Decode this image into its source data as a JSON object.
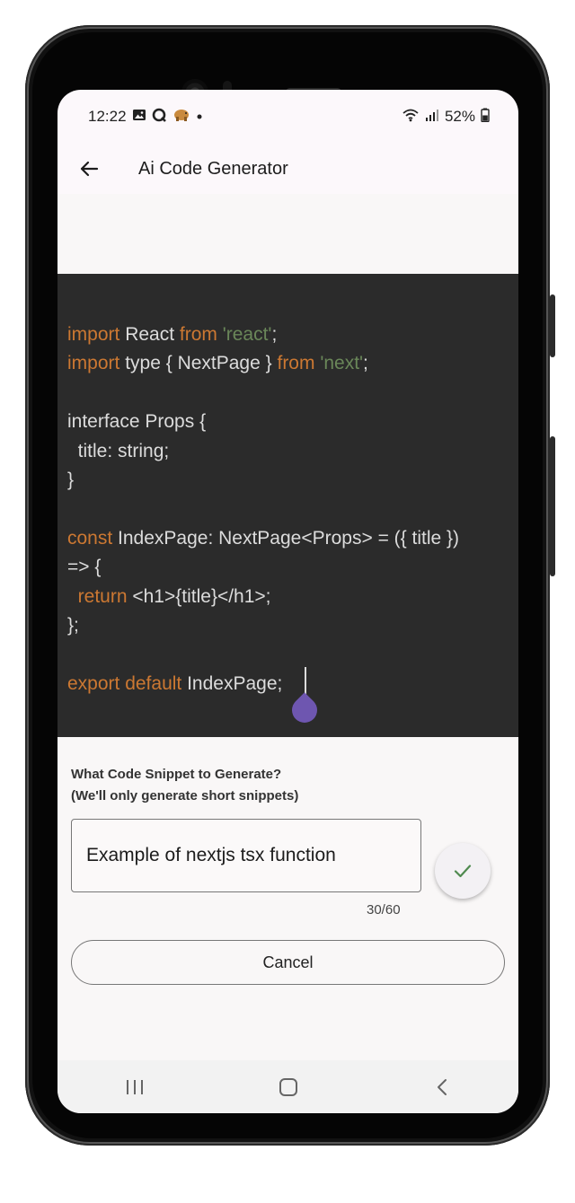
{
  "status_bar": {
    "time": "12:22",
    "battery": "52%",
    "left_icons": [
      "image-icon",
      "search-app-icon",
      "mastodon-icon",
      "dot-icon"
    ],
    "right_icons": [
      "wifi-icon",
      "signal-icon",
      "battery-icon"
    ]
  },
  "app_bar": {
    "title": "Ai Code Generator",
    "back_icon": "arrow-left-icon"
  },
  "code": {
    "colors": {
      "background": "#2b2b2b",
      "keyword": "#cc7832",
      "string": "#6a8759",
      "text": "#dcdcdc"
    },
    "lines": [
      [
        {
          "t": "import",
          "c": "kw"
        },
        {
          "t": " React ",
          "c": ""
        },
        {
          "t": "from",
          "c": "kw"
        },
        {
          "t": " ",
          "c": ""
        },
        {
          "t": "'react'",
          "c": "str"
        },
        {
          "t": ";",
          "c": ""
        }
      ],
      [
        {
          "t": "import",
          "c": "kw"
        },
        {
          "t": " type { NextPage } ",
          "c": ""
        },
        {
          "t": "from",
          "c": "kw"
        },
        {
          "t": " ",
          "c": ""
        },
        {
          "t": "'next'",
          "c": "str"
        },
        {
          "t": ";",
          "c": ""
        }
      ],
      [],
      [
        {
          "t": "interface Props {",
          "c": ""
        }
      ],
      [
        {
          "t": "  title: string;",
          "c": ""
        }
      ],
      [
        {
          "t": "}",
          "c": ""
        }
      ],
      [],
      [
        {
          "t": "const",
          "c": "kw"
        },
        {
          "t": " IndexPage: NextPage<Props> = ({ title })",
          "c": ""
        }
      ],
      [
        {
          "t": "=> {",
          "c": ""
        }
      ],
      [
        {
          "t": "  ",
          "c": ""
        },
        {
          "t": "return",
          "c": "kw"
        },
        {
          "t": " <h1>{title}</h1>;",
          "c": ""
        }
      ],
      [
        {
          "t": "};",
          "c": ""
        }
      ],
      [],
      [
        {
          "t": "export default",
          "c": "kw"
        },
        {
          "t": " IndexPage;",
          "c": ""
        }
      ]
    ]
  },
  "form": {
    "label_line1": "What Code Snippet to Generate?",
    "label_line2": "(We'll only generate short snippets)",
    "input_value": "Example of nextjs tsx function",
    "counter": "30/60",
    "confirm_icon": "check-icon",
    "confirm_color": "#4f8a4f",
    "cancel_label": "Cancel"
  },
  "nav_bar": {
    "icons": [
      "recent-apps-icon",
      "home-icon",
      "back-nav-icon"
    ]
  }
}
